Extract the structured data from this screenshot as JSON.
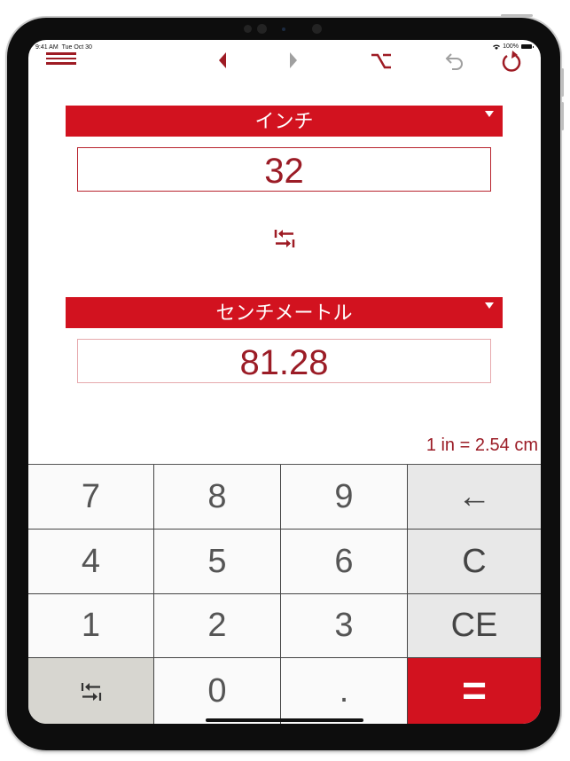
{
  "status_bar": {
    "time": "9:41 AM",
    "date": "Tue Oct 30",
    "battery": "100%"
  },
  "toolbar": {
    "icons": [
      "menu-icon",
      "back-arrow-icon",
      "forward-arrow-icon",
      "option-key-icon",
      "undo-icon",
      "reset-icon"
    ]
  },
  "converter": {
    "from_unit": "インチ",
    "from_value": "32",
    "to_unit": "センチメートル",
    "to_value": "81.28",
    "ratio": "1 in = 2.54 cm"
  },
  "keypad": {
    "keys": [
      {
        "label": "7"
      },
      {
        "label": "8"
      },
      {
        "label": "9"
      },
      {
        "label": "←"
      },
      {
        "label": "4"
      },
      {
        "label": "5"
      },
      {
        "label": "6"
      },
      {
        "label": "C"
      },
      {
        "label": "1"
      },
      {
        "label": "2"
      },
      {
        "label": "3"
      },
      {
        "label": "CE"
      },
      {
        "label": ""
      },
      {
        "label": "0"
      },
      {
        "label": "."
      },
      {
        "label": "="
      }
    ]
  },
  "colors": {
    "accent": "#d2121f",
    "text_value": "#9b1c26",
    "disabled": "#a0a0a0"
  }
}
